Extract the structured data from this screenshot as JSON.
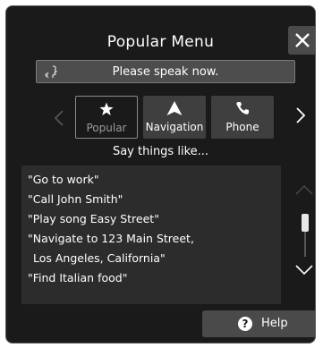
{
  "header": {
    "title": "Popular Menu"
  },
  "speak_bar": {
    "prompt": "Please speak now."
  },
  "tabs": [
    {
      "label": "Popular",
      "icon": "star-icon",
      "selected": true
    },
    {
      "label": "Navigation",
      "icon": "navigation-arrow-icon",
      "selected": false
    },
    {
      "label": "Phone",
      "icon": "phone-icon",
      "selected": false
    }
  ],
  "say_things_label": "Say things like...",
  "commands": [
    "\"Go to work\"",
    "\"Call John Smith\"",
    "\"Play song Easy Street\"",
    "\"Navigate to 123 Main Street,",
    "Los Angeles, California\"",
    "\"Find Italian food\""
  ],
  "help_button": {
    "label": "Help",
    "icon": "help-icon"
  },
  "colors": {
    "panel_background": "#1a1a1a",
    "button_background": "#4a4a4a",
    "list_background": "#2c2c2c",
    "text": "#ffffff",
    "muted_text": "#9a9a9a"
  }
}
